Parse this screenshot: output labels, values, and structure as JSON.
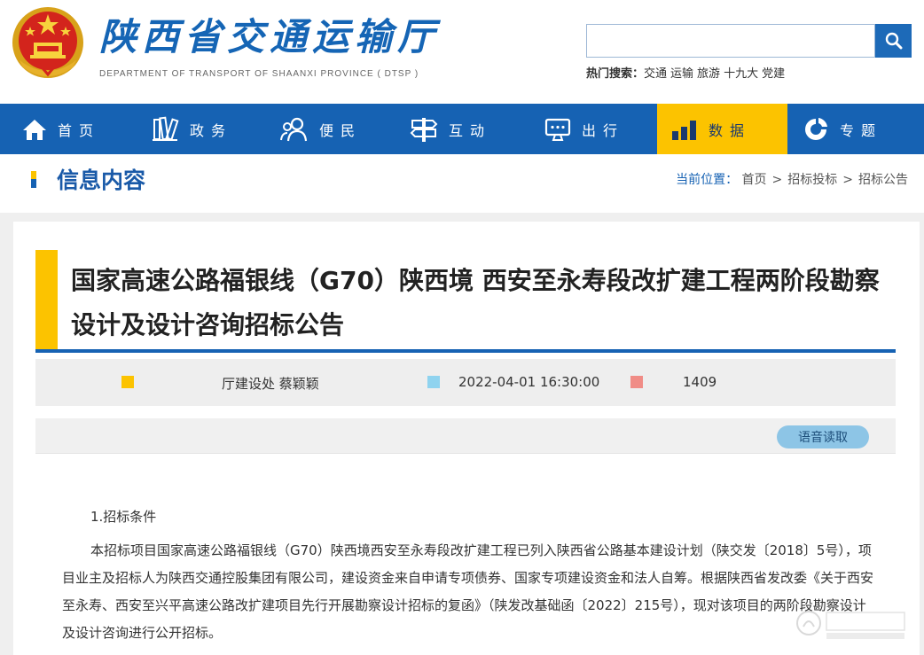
{
  "header": {
    "site_title": "陕西省交通运输厅",
    "site_subtitle": "DEPARTMENT OF TRANSPORT OF SHAANXI PROVINCE ( DTSP )",
    "search": {
      "placeholder": "",
      "button_icon": "search-icon"
    },
    "hot_search": {
      "label": "热门搜索：",
      "keywords": [
        "交通",
        "运输",
        "旅游",
        "十九大",
        "党建"
      ]
    }
  },
  "nav": {
    "items": [
      {
        "label": "首页",
        "icon": "home-icon"
      },
      {
        "label": "政务",
        "icon": "books-icon"
      },
      {
        "label": "便民",
        "icon": "people-icon"
      },
      {
        "label": "互动",
        "icon": "signpost-icon"
      },
      {
        "label": "出行",
        "icon": "monitor-icon"
      },
      {
        "label": "数据",
        "icon": "bar-chart-icon",
        "active": true
      },
      {
        "label": "专题",
        "icon": "ring-icon"
      }
    ]
  },
  "section": {
    "title": "信息内容",
    "breadcrumb_label": "当前位置：",
    "breadcrumb": [
      "首页",
      "招标投标",
      "招标公告"
    ]
  },
  "article": {
    "title": "国家高速公路福银线（G70）陕西境 西安至永寿段改扩建工程两阶段勘察设计及设计咨询招标公告",
    "author": "厅建设处 蔡颖颖",
    "date": "2022-04-01 16:30:00",
    "views": "1409",
    "read_button": "语音读取",
    "section_heading": "1.招标条件",
    "paragraph": "本招标项目国家高速公路福银线（G70）陕西境西安至永寿段改扩建工程已列入陕西省公路基本建设计划（陕交发〔2018〕5号），项目业主及招标人为陕西交通控股集团有限公司，建设资金来自申请专项债券、国家专项建设资金和法人自筹。根据陕西省发改委《关于西安至永寿、西安至兴平高速公路改扩建项目先行开展勘察设计招标的复函》（陕发改基础函〔2022〕215号），现对该项目的两阶段勘察设计及设计咨询进行公开招标。"
  },
  "colors": {
    "brand_blue": "#1662b3",
    "accent_yellow": "#fcc300",
    "meta_author": "#fcc300",
    "meta_date": "#8fd3ef",
    "meta_views": "#f08c86"
  }
}
